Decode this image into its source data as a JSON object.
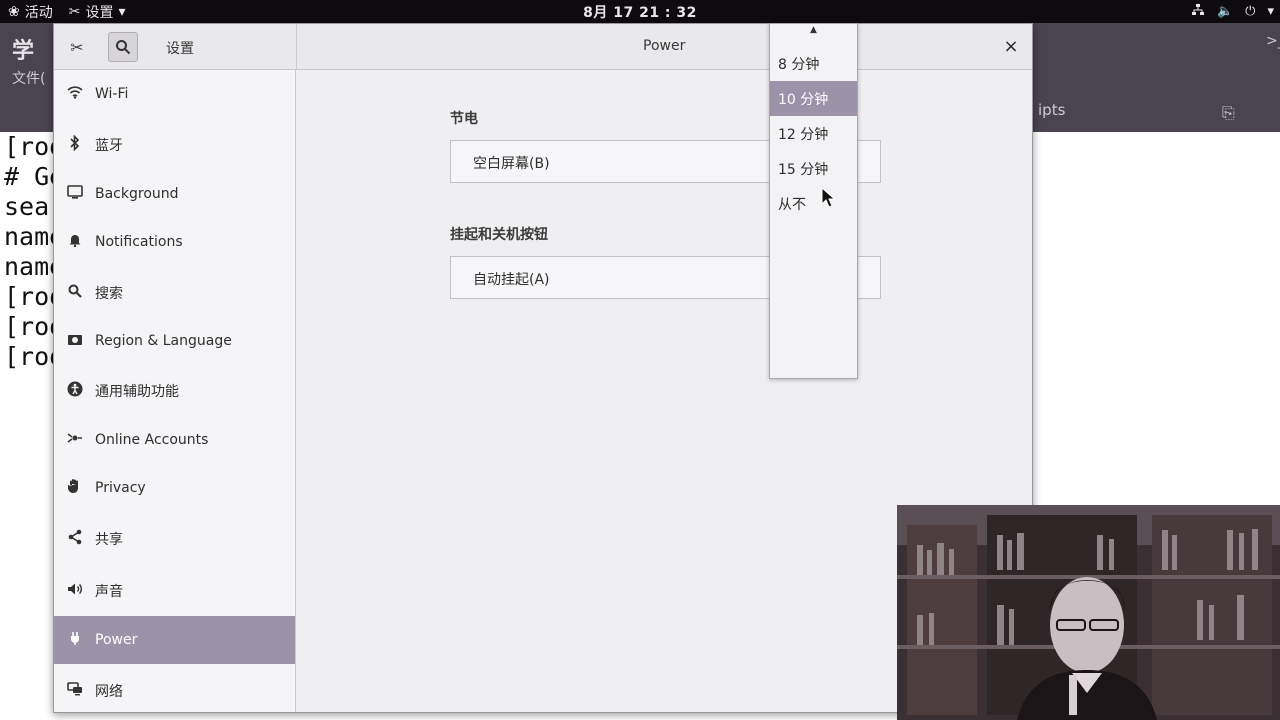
{
  "topbar": {
    "activities": "活动",
    "app_menu": "设置",
    "clock": "8月 17  21 : 32"
  },
  "terminal": {
    "title": "学",
    "menu": "文件(",
    "tab_fragment": "ipts",
    "lines": [
      "[roo",
      "# Ge",
      "sea",
      "name",
      "name",
      "[roo",
      "[roo",
      "[roo"
    ]
  },
  "window": {
    "app_title": "设置",
    "page_title": "Power",
    "close": "×"
  },
  "sidebar": {
    "items": [
      {
        "label": "Wi-Fi",
        "icon": "wifi-icon"
      },
      {
        "label": "蓝牙",
        "icon": "bluetooth-icon"
      },
      {
        "label": "Background",
        "icon": "background-icon"
      },
      {
        "label": "Notifications",
        "icon": "bell-icon"
      },
      {
        "label": "搜索",
        "icon": "search-icon"
      },
      {
        "label": "Region & Language",
        "icon": "region-icon"
      },
      {
        "label": "通用辅助功能",
        "icon": "accessibility-icon"
      },
      {
        "label": "Online Accounts",
        "icon": "online-accounts-icon"
      },
      {
        "label": "Privacy",
        "icon": "hand-icon"
      },
      {
        "label": "共享",
        "icon": "share-icon"
      },
      {
        "label": "声音",
        "icon": "speaker-icon"
      },
      {
        "label": "Power",
        "icon": "power-plug-icon",
        "active": true
      },
      {
        "label": "网络",
        "icon": "network-icon"
      }
    ]
  },
  "power": {
    "section_saving": "节电",
    "blank_screen_label": "空白屏幕(B)",
    "section_suspend": "挂起和关机按钮",
    "auto_suspend_label": "自动挂起(A)"
  },
  "dropdown": {
    "options": [
      "8 分钟",
      "10 分钟",
      "12 分钟",
      "15 分钟",
      "从不"
    ],
    "selected": "10 分钟"
  },
  "colors": {
    "accent": "#9d93a8",
    "topbar": "#0d0b0e",
    "window_bg": "#efeef0"
  }
}
